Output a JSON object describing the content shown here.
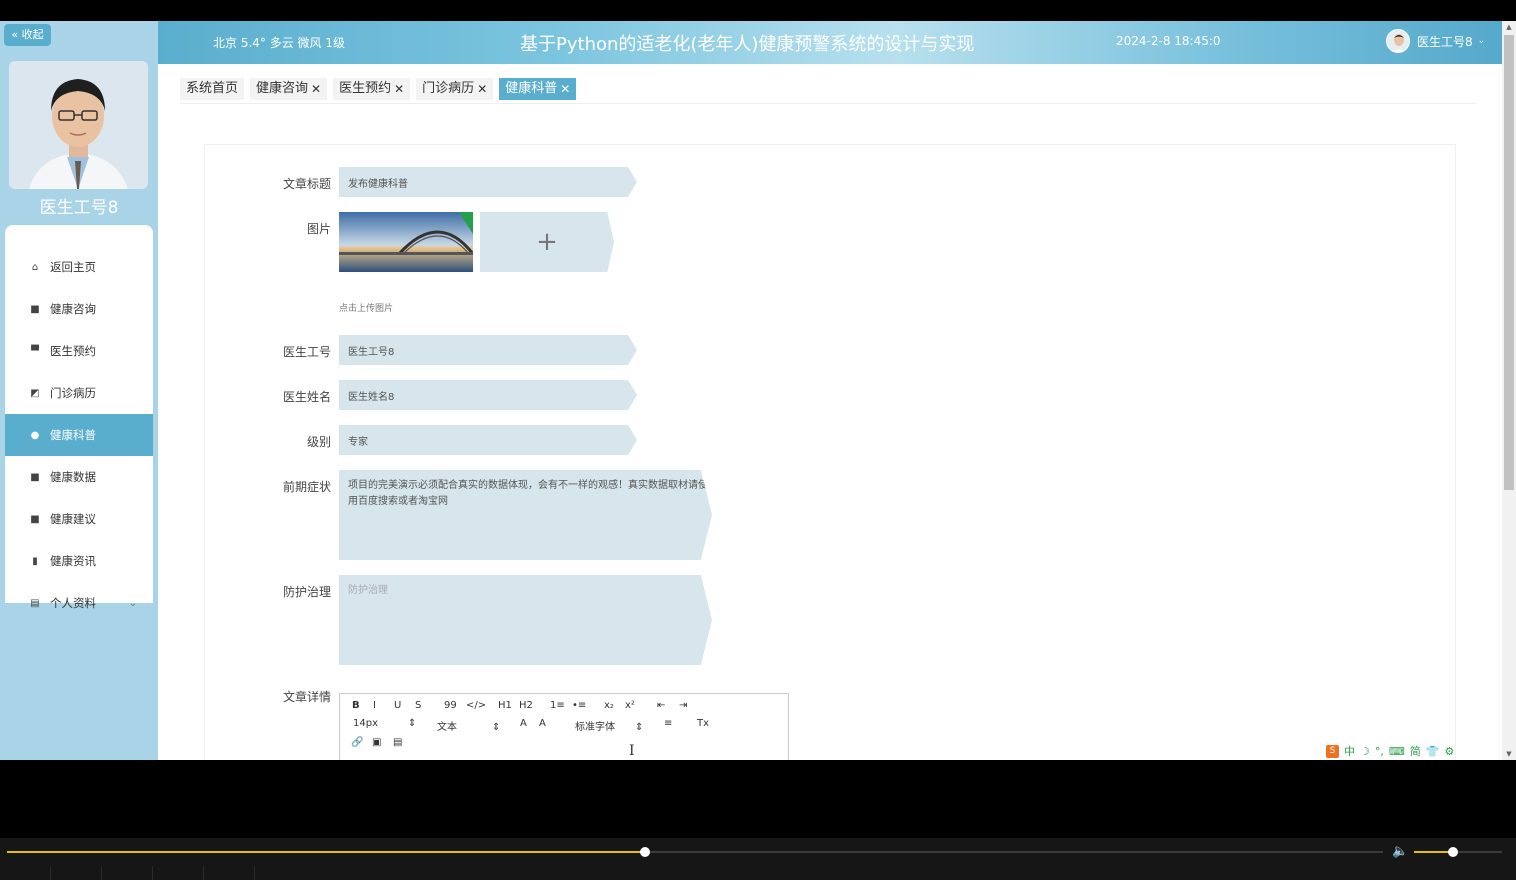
{
  "sidebar": {
    "collapse_label": "« 收起",
    "username": "医生工号8",
    "menu": [
      {
        "label": "返回主页",
        "icon": "home-icon",
        "glyph": "⌂",
        "active": false
      },
      {
        "label": "健康咨询",
        "icon": "grid-icon",
        "glyph": "■",
        "active": false
      },
      {
        "label": "医生预约",
        "icon": "monitor-icon",
        "glyph": "▀",
        "active": false
      },
      {
        "label": "门诊病历",
        "icon": "chart-box-icon",
        "glyph": "◩",
        "active": false
      },
      {
        "label": "健康科普",
        "icon": "bulb-icon",
        "glyph": "●",
        "active": true
      },
      {
        "label": "健康数据",
        "icon": "grid-icon",
        "glyph": "■",
        "active": false
      },
      {
        "label": "健康建议",
        "icon": "grid-icon",
        "glyph": "■",
        "active": false
      },
      {
        "label": "健康资讯",
        "icon": "bar-chart-icon",
        "glyph": "▮",
        "active": false
      },
      {
        "label": "个人资料",
        "icon": "card-icon",
        "glyph": "▤",
        "active": false,
        "has_children": true
      }
    ]
  },
  "header": {
    "weather": "北京  5.4°  多云  微风  1级",
    "title": "基于Python的适老化(老年人)健康预警系统的设计与实现",
    "datetime": "2024-2-8 18:45:0",
    "user": "医生工号8"
  },
  "tabs": [
    {
      "label": "系统首页",
      "closable": false,
      "active": false
    },
    {
      "label": "健康咨询",
      "closable": true,
      "active": false
    },
    {
      "label": "医生预约",
      "closable": true,
      "active": false
    },
    {
      "label": "门诊病历",
      "closable": true,
      "active": false
    },
    {
      "label": "健康科普",
      "closable": true,
      "active": true
    }
  ],
  "form": {
    "title": {
      "label": "文章标题",
      "value": "发布健康科普"
    },
    "image": {
      "label": "图片",
      "hint": "点击上传图片"
    },
    "doctor_id": {
      "label": "医生工号",
      "value": "医生工号8"
    },
    "doctor_name": {
      "label": "医生姓名",
      "value": "医生姓名8"
    },
    "level": {
      "label": "级别",
      "value": "专家"
    },
    "symptoms": {
      "label": "前期症状",
      "value": "项目的完美演示必须配合真实的数据体现，会有不一样的观感！真实数据取材请使用百度搜索或者淘宝网"
    },
    "treatment": {
      "label": "防护治理",
      "placeholder": "防护治理"
    },
    "detail": {
      "label": "文章详情"
    }
  },
  "editor": {
    "font_size": "14px",
    "block_type": "文本",
    "font_family": "标准字体",
    "buttons": [
      "B",
      "I",
      "U",
      "S",
      "99",
      "</>",
      "H1",
      "H2",
      "1≡",
      "•≡",
      "x₂",
      "x²",
      "⇤",
      "⇥",
      "A",
      "A",
      "≡",
      "Tx"
    ]
  },
  "ime": [
    "中",
    "☽",
    "°,",
    "⌨",
    "简",
    "👕",
    "⚙"
  ],
  "player": {
    "progress": 0.464,
    "volume": 0.44
  }
}
